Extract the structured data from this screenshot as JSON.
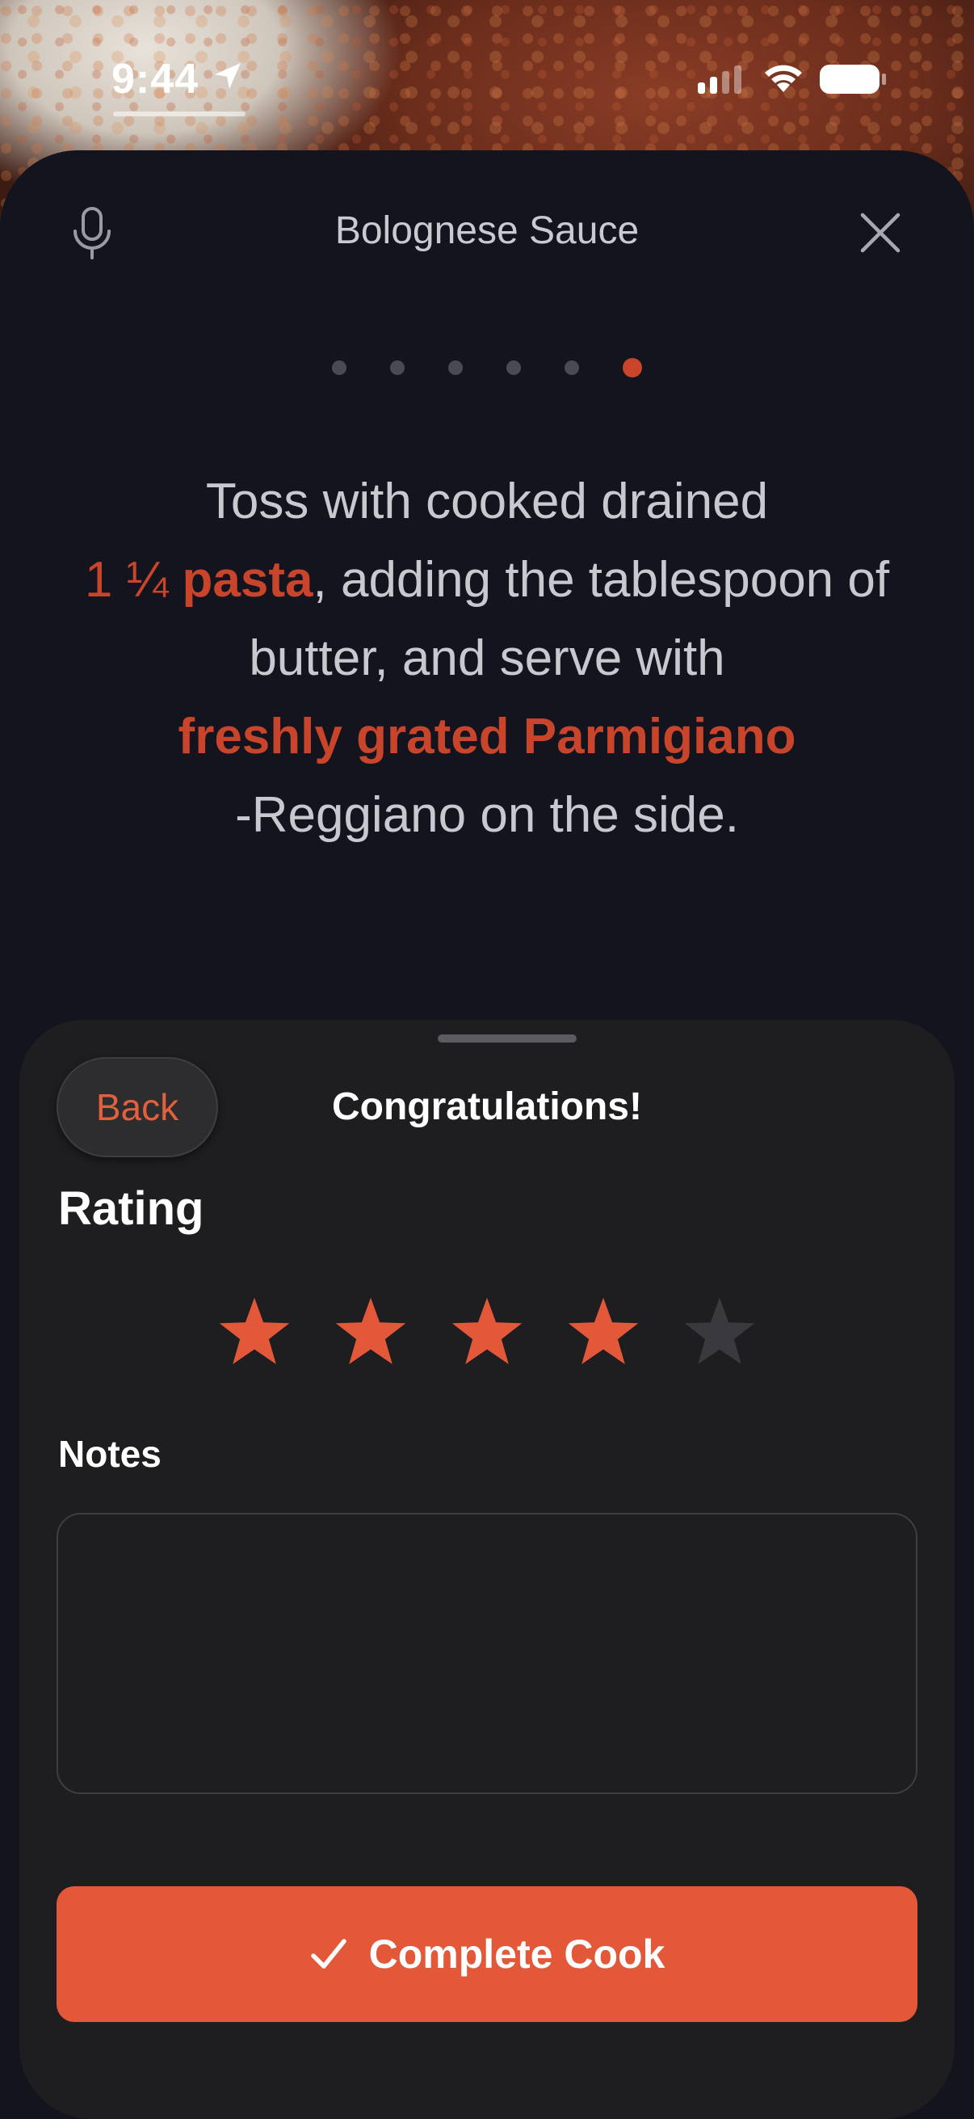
{
  "status_bar": {
    "time": "9:44"
  },
  "header": {
    "title": "Bolognese Sauce",
    "mic_icon": "microphone-icon",
    "close_icon": "close-icon"
  },
  "steps": {
    "total": 6,
    "current": 6
  },
  "instruction": {
    "part1": "Toss with cooked drained",
    "qty": "1 ¼",
    "ingredient1": "pasta",
    "part2": ", adding the tablespoon of butter, and serve with",
    "ingredient2": "freshly grated Parmigiano",
    "part3": "-Reggiano on the side."
  },
  "sheet": {
    "back_label": "Back",
    "title": "Congratulations!",
    "rating_label": "Rating",
    "rating_value": 4,
    "rating_max": 5,
    "notes_label": "Notes",
    "notes_value": "",
    "complete_label": "Complete Cook"
  },
  "colors": {
    "accent": "#e4583a",
    "highlight": "#c8452b",
    "card_bg": "#14141f",
    "sheet_bg": "#1e1e20",
    "star_inactive": "#3a3a3e"
  }
}
